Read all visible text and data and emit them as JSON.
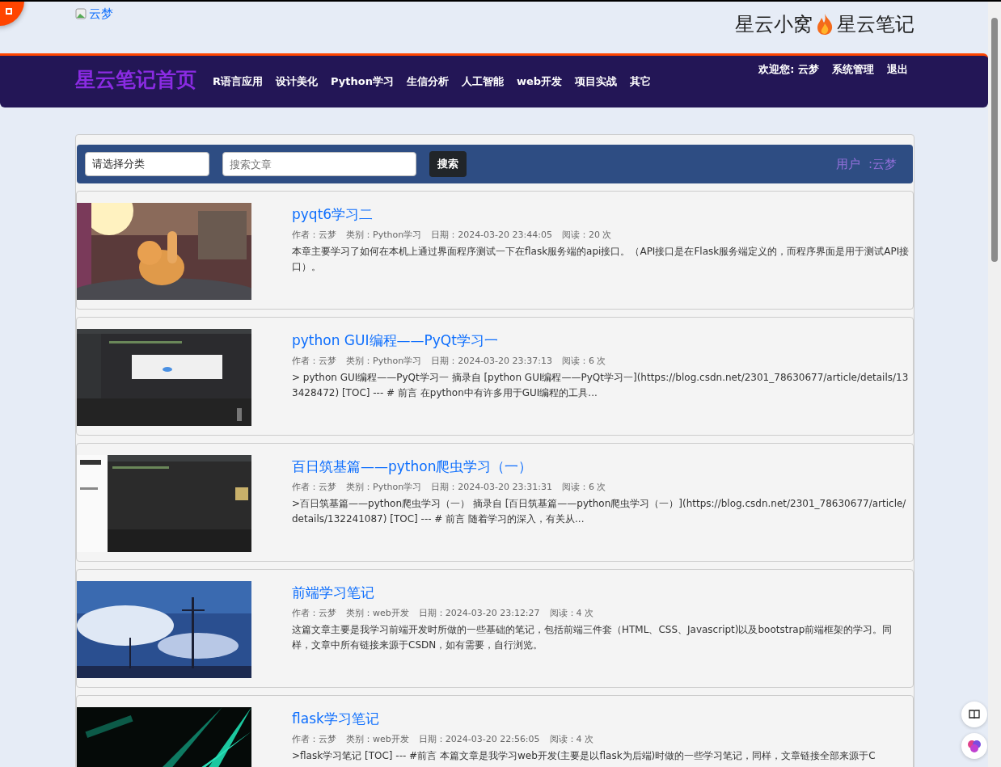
{
  "header": {
    "logo_alt": "云梦",
    "site_title_left": "星云小窝",
    "site_title_right": "星云笔记"
  },
  "navbar": {
    "brand": "星云笔记首页",
    "links": [
      "R语言应用",
      "设计美化",
      "Python学习",
      "生信分析",
      "人工智能",
      "web开发",
      "项目实战",
      "其它"
    ],
    "user_links": [
      "欢迎您: 云梦",
      "系统管理",
      "退出"
    ]
  },
  "search": {
    "category_select": "请选择分类",
    "placeholder": "搜索文章",
    "button": "搜索",
    "user_label": "用户  :云梦"
  },
  "articles": [
    {
      "title": "pyqt6学习二",
      "author": "作者：云梦",
      "category": "类别：Python学习",
      "date": "日期：2024-03-20 23:44:05",
      "reads": "阅读：20 次",
      "excerpt": "本章主要学习了如何在本机上通过界面程序测试一下在flask服务端的api接口。（API接口是在Flask服务端定义的，而程序界面是用于测试API接口）。"
    },
    {
      "title": "python GUI编程——PyQt学习一",
      "author": "作者：云梦",
      "category": "类别：Python学习",
      "date": "日期：2024-03-20 23:37:13",
      "reads": "阅读：6 次",
      "excerpt": "> python GUI编程——PyQt学习一 摘录自 [python GUI编程——PyQt学习一](https://blog.csdn.net/2301_78630677/article/details/133428472) [TOC] --- # 前言 在python中有许多用于GUI编程的工具..."
    },
    {
      "title": "百日筑基篇——python爬虫学习（一）",
      "author": "作者：云梦",
      "category": "类别：Python学习",
      "date": "日期：2024-03-20 23:31:31",
      "reads": "阅读：6 次",
      "excerpt": ">百日筑基篇——python爬虫学习（一） 摘录自 [百日筑基篇——python爬虫学习（一）](https://blog.csdn.net/2301_78630677/article/details/132241087) [TOC] --- # 前言 随着学习的深入，有关从..."
    },
    {
      "title": "前端学习笔记",
      "author": "作者：云梦",
      "category": "类别：web开发",
      "date": "日期：2024-03-20 23:12:27",
      "reads": "阅读：4 次",
      "excerpt": "这篇文章主要是我学习前端开发时所做的一些基础的笔记，包括前端三件套（HTML、CSS、Javascript)以及bootstrap前端框架的学习。同样，文章中所有链接来源于CSDN，如有需要，自行浏览。"
    },
    {
      "title": "flask学习笔记",
      "author": "作者：云梦",
      "category": "类别：web开发",
      "date": "日期：2024-03-20 22:56:05",
      "reads": "阅读：4 次",
      "excerpt": ">flask学习笔记 [TOC] --- #前言 本篇文章是我学习web开发(主要是以flask为后端)时做的一些学习笔记，同样，文章链接全部来源于C"
    }
  ]
}
